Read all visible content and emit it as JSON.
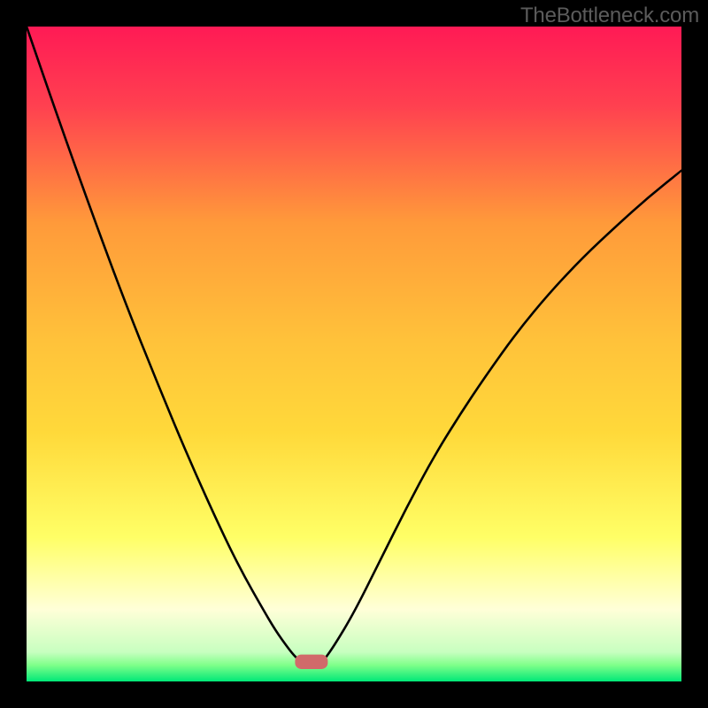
{
  "watermark": "TheBottleneck.com",
  "chart_data": {
    "type": "line",
    "title": "",
    "xlabel": "",
    "ylabel": "",
    "xlim": [
      0,
      1
    ],
    "ylim": [
      0,
      1
    ],
    "background_gradient": {
      "top": "#ff1a55",
      "upper_mid": "#ff9a3a",
      "mid": "#ffd93a",
      "lower_mid": "#ffff66",
      "near_bottom": "#ffffd8",
      "bottom1": "#7fff8a",
      "bottom2": "#00e878"
    },
    "series": [
      {
        "name": "left-curve",
        "x": [
          0.0,
          0.05,
          0.1,
          0.15,
          0.2,
          0.25,
          0.3,
          0.33,
          0.36,
          0.38,
          0.4,
          0.41,
          0.415
        ],
        "y": [
          1.0,
          0.855,
          0.715,
          0.58,
          0.455,
          0.335,
          0.225,
          0.165,
          0.112,
          0.078,
          0.05,
          0.038,
          0.034
        ]
      },
      {
        "name": "right-curve",
        "x": [
          0.455,
          0.47,
          0.5,
          0.54,
          0.58,
          0.62,
          0.66,
          0.7,
          0.75,
          0.8,
          0.85,
          0.9,
          0.95,
          1.0
        ],
        "y": [
          0.034,
          0.055,
          0.105,
          0.185,
          0.265,
          0.34,
          0.405,
          0.465,
          0.535,
          0.595,
          0.648,
          0.695,
          0.74,
          0.78
        ]
      }
    ],
    "marker": {
      "name": "valley-marker",
      "x_center": 0.435,
      "y": 0.03,
      "width": 0.05,
      "height": 0.022,
      "color": "#d16a6a"
    }
  }
}
